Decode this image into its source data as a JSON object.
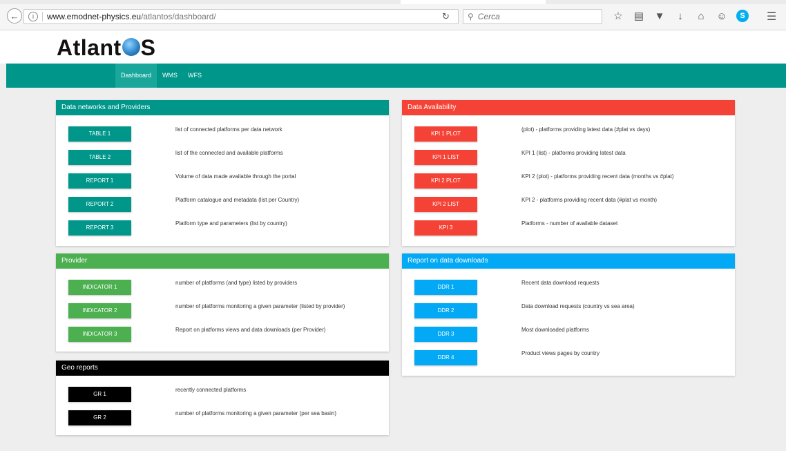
{
  "browser": {
    "url_domain": "www.emodnet-physics.eu",
    "url_path": "/atlantos/dashboard/",
    "search_placeholder": "Cerca"
  },
  "logo": {
    "text_before": "Atlant",
    "text_after": "S"
  },
  "nav": {
    "items": [
      {
        "label": "Dashboard",
        "active": true
      },
      {
        "label": "WMS",
        "active": false
      },
      {
        "label": "WFS",
        "active": false
      }
    ]
  },
  "panels": {
    "networks": {
      "title": "Data networks and Providers",
      "color": "#00968a",
      "rows": [
        {
          "button": "TABLE 1",
          "desc": "list of connected platforms per data network"
        },
        {
          "button": "TABLE 2",
          "desc": "list of the connected and available platforms"
        },
        {
          "button": "REPORT 1",
          "desc": "Volume of data made available through the portal"
        },
        {
          "button": "REPORT 2",
          "desc": "Platform catalogue and metadata (list per Country)"
        },
        {
          "button": "REPORT 3",
          "desc": "Platform type and parameters (list by country)"
        }
      ]
    },
    "availability": {
      "title": "Data Availability",
      "color": "#f44336",
      "rows": [
        {
          "button": "KPI 1 PLOT",
          "desc": "(plot) - platforms providing latest data (#plat vs days)"
        },
        {
          "button": "KPI 1 LIST",
          "desc": "KPI 1 (list) - platforms providing latest data"
        },
        {
          "button": "KPI 2 PLOT",
          "desc": "KPI 2 (plot) - platforms providing recent data (months vs #plat)"
        },
        {
          "button": "KPI 2 LIST",
          "desc": "KPI 2 - platforms providing recent data (#plat vs month)"
        },
        {
          "button": "KPI 3",
          "desc": "Platforms - number of available dataset"
        }
      ]
    },
    "provider": {
      "title": "Provider",
      "color": "#4caf50",
      "rows": [
        {
          "button": "INDICATOR 1",
          "desc": "number of platforms (and type) listed by providers"
        },
        {
          "button": "INDICATOR 2",
          "desc": "number of platforms monitoring a given parameter (listed by provider)"
        },
        {
          "button": "INDICATOR 3",
          "desc": "Report on platforms views and data downloads (per Provider)"
        }
      ]
    },
    "downloads": {
      "title": "Report on data downloads",
      "color": "#03a9f4",
      "rows": [
        {
          "button": "DDR 1",
          "desc": "Recent data download requests"
        },
        {
          "button": "DDR 2",
          "desc": "Data download requests (country vs sea area)"
        },
        {
          "button": "DDR 3",
          "desc": "Most downloaded platforms"
        },
        {
          "button": "DDR 4",
          "desc": "Product views pages by country"
        }
      ]
    },
    "geo": {
      "title": "Geo reports",
      "color": "#000000",
      "rows": [
        {
          "button": "GR 1",
          "desc": "recently connected platforms"
        },
        {
          "button": "GR 2",
          "desc": "number of platforms monitoring a given parameter (per sea basin)"
        }
      ]
    }
  }
}
